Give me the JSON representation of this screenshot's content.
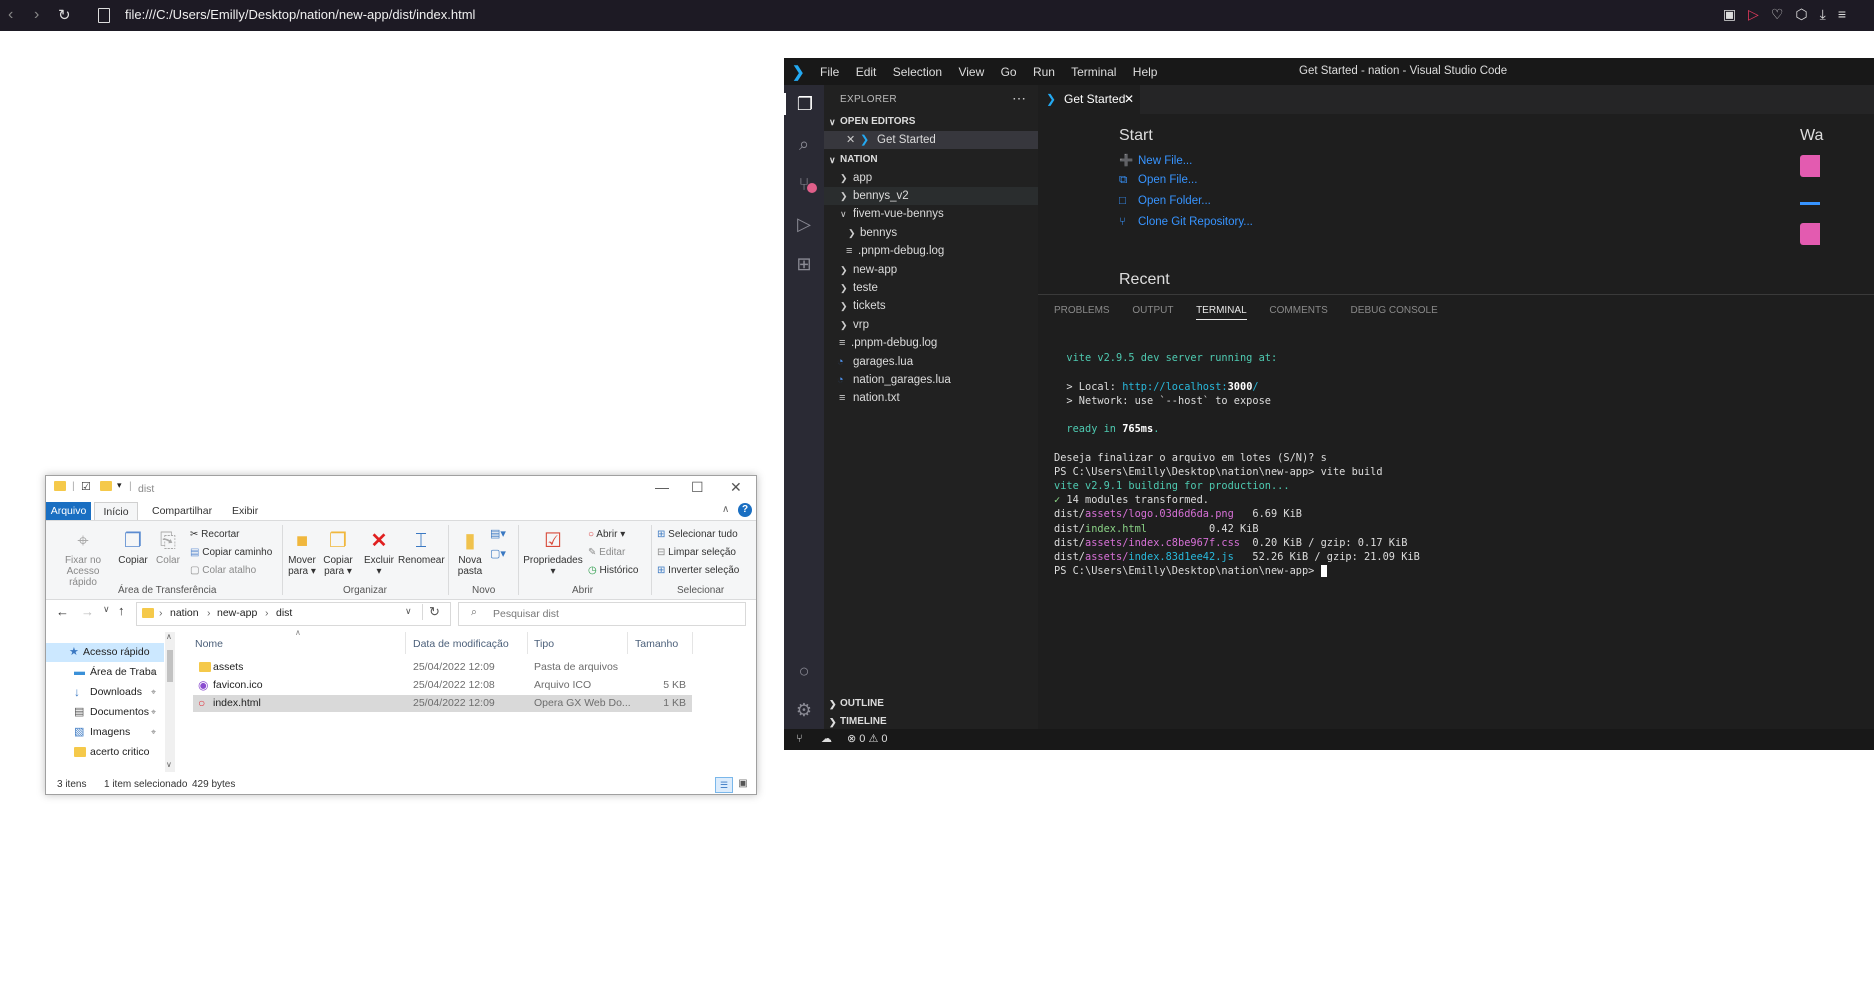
{
  "browser": {
    "url": "file:///C:/Users/Emilly/Desktop/nation/new-app/dist/index.html"
  },
  "vscode": {
    "menu": [
      "File",
      "Edit",
      "Selection",
      "View",
      "Go",
      "Run",
      "Terminal",
      "Help"
    ],
    "window_title": "Get Started - nation - Visual Studio Code",
    "sidebar_header": "EXPLORER",
    "open_editors_header": "OPEN EDITORS",
    "open_editor_item": "Get Started",
    "project_header": "NATION",
    "tree": [
      {
        "label": "app",
        "kind": "folder",
        "depth": 0
      },
      {
        "label": "bennys_v2",
        "kind": "folder",
        "depth": 0
      },
      {
        "label": "fivem-vue-bennys",
        "kind": "folder-open",
        "depth": 0
      },
      {
        "label": "bennys",
        "kind": "folder",
        "depth": 1
      },
      {
        "label": ".pnpm-debug.log",
        "kind": "file",
        "depth": 1
      },
      {
        "label": "new-app",
        "kind": "folder",
        "depth": 0
      },
      {
        "label": "teste",
        "kind": "folder",
        "depth": 0
      },
      {
        "label": "tickets",
        "kind": "folder",
        "depth": 0
      },
      {
        "label": "vrp",
        "kind": "folder",
        "depth": 0
      },
      {
        "label": ".pnpm-debug.log",
        "kind": "file",
        "depth": 0
      },
      {
        "label": "garages.lua",
        "kind": "lua",
        "depth": 0
      },
      {
        "label": "nation_garages.lua",
        "kind": "lua",
        "depth": 0
      },
      {
        "label": "nation.txt",
        "kind": "file",
        "depth": 0
      }
    ],
    "outline_header": "OUTLINE",
    "timeline_header": "TIMELINE",
    "tab_label": "Get Started",
    "welcome": {
      "start_title": "Start",
      "links": [
        "New File...",
        "Open File...",
        "Open Folder...",
        "Clone Git Repository..."
      ],
      "recent_title": "Recent",
      "walk_partial": "Wa"
    },
    "panel_tabs": [
      "PROBLEMS",
      "OUTPUT",
      "TERMINAL",
      "COMMENTS",
      "DEBUG CONSOLE"
    ],
    "terminal": {
      "dev_server": "vite v2.9.5 dev server running at:",
      "local_label": "> Local: ",
      "local_url_a": "http://localhost:",
      "local_port": "3000",
      "local_url_b": "/",
      "network": "> Network: use `--host` to expose",
      "ready_a": "ready in ",
      "ready_ms": "765ms",
      "ready_b": ".",
      "prompt_q": "Deseja finalizar o arquivo em lotes (S/N)? s",
      "ps_prompt": "PS C:\\Users\\Emilly\\Desktop\\nation\\new-app> ",
      "cmd": "vite build",
      "building": "vite v2.9.1 building for production...",
      "check": "✓",
      "transformed": " 14 modules transformed.",
      "outputs": [
        {
          "dir": "dist/",
          "sub": "assets/",
          "file": "logo.03d6d6da.png",
          "size": "   6.69 KiB",
          "color": "m",
          "gz": ""
        },
        {
          "dir": "dist/",
          "sub": "",
          "file": "index.html",
          "size": "          0.42 KiB",
          "color": "gr",
          "gz": ""
        },
        {
          "dir": "dist/",
          "sub": "assets/",
          "file": "index.c8be967f.css",
          "size": "  0.20 KiB",
          "color": "m",
          "gz": " / gzip: 0.17 KiB"
        },
        {
          "dir": "dist/",
          "sub": "assets/",
          "file": "index.83d1ee42.js",
          "size": "   52.26 KiB",
          "color": "c",
          "gz": " / gzip: 21.09 KiB"
        }
      ],
      "final_prompt": "PS C:\\Users\\Emilly\\Desktop\\nation\\new-app> "
    },
    "status": {
      "errors": "0",
      "warnings": "0"
    }
  },
  "explorer": {
    "title": "dist",
    "tabs": [
      "Arquivo",
      "Início",
      "Compartilhar",
      "Exibir"
    ],
    "ribbon": {
      "pin": "Fixar no Acesso rápido",
      "copy": "Copiar",
      "paste": "Colar",
      "cut": "Recortar",
      "copy_path": "Copiar caminho",
      "paste_shortcut": "Colar atalho",
      "group_clipboard": "Área de Transferência",
      "move_to": "Mover para",
      "copy_to": "Copiar para",
      "delete": "Excluir",
      "rename": "Renomear",
      "group_organize": "Organizar",
      "new_folder": "Nova pasta",
      "group_new": "Novo",
      "properties": "Propriedades",
      "open": "Abrir",
      "edit": "Editar",
      "history": "Histórico",
      "group_open": "Abrir",
      "select_all": "Selecionar tudo",
      "clear_selection": "Limpar seleção",
      "invert_selection": "Inverter seleção",
      "group_select": "Selecionar"
    },
    "breadcrumb": [
      "nation",
      "new-app",
      "dist"
    ],
    "search_placeholder": "Pesquisar dist",
    "nav": [
      {
        "label": "Acesso rápido",
        "pin": false,
        "selected": true
      },
      {
        "label": "Área de Traba",
        "pin": true
      },
      {
        "label": "Downloads",
        "pin": true
      },
      {
        "label": "Documentos",
        "pin": true
      },
      {
        "label": "Imagens",
        "pin": true
      },
      {
        "label": "acerto critico",
        "pin": false
      }
    ],
    "columns": [
      "Nome",
      "Data de modificação",
      "Tipo",
      "Tamanho"
    ],
    "files": [
      {
        "name": "assets",
        "date": "25/04/2022 12:09",
        "type": "Pasta de arquivos",
        "size": ""
      },
      {
        "name": "favicon.ico",
        "date": "25/04/2022 12:08",
        "type": "Arquivo ICO",
        "size": "5 KB"
      },
      {
        "name": "index.html",
        "date": "25/04/2022 12:09",
        "type": "Opera GX Web Do...",
        "size": "1 KB"
      }
    ],
    "status": {
      "count": "3 itens",
      "selected": "1 item selecionado",
      "bytes": "429 bytes"
    }
  }
}
